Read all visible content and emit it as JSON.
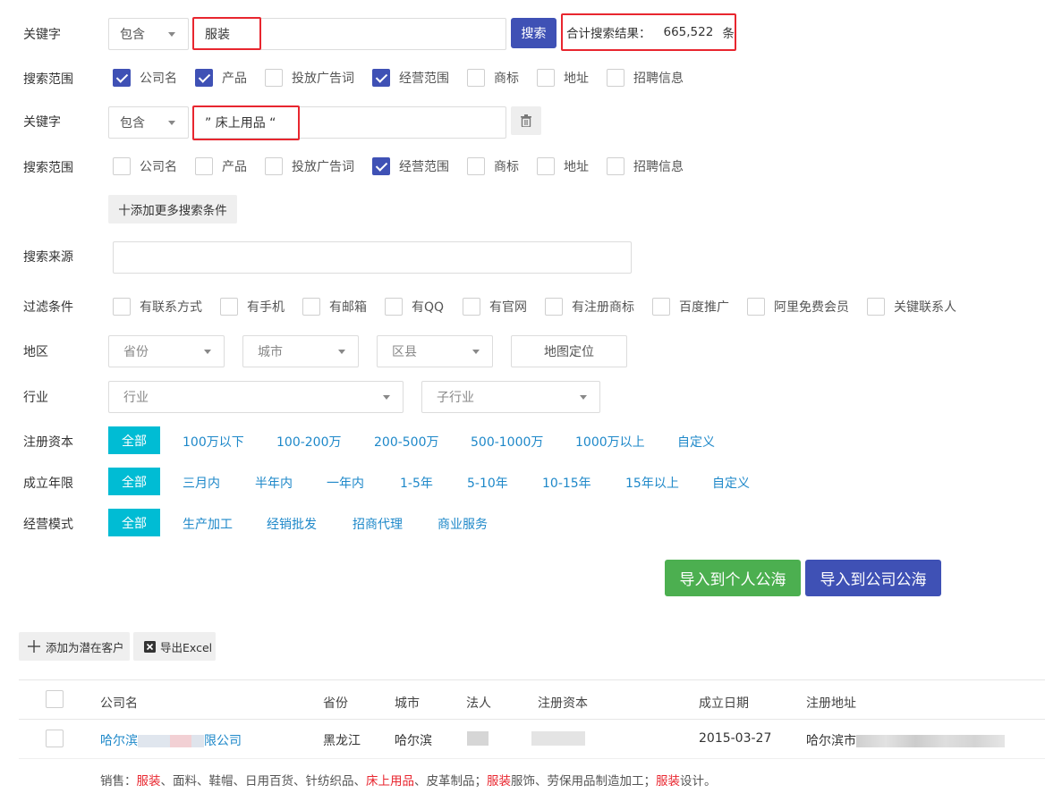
{
  "row1": {
    "label": "关键字",
    "match": "包含",
    "keyword": "服装",
    "search_btn": "搜索",
    "total_label": "合计搜索结果：",
    "total_count": "665,522",
    "total_unit": "条"
  },
  "scope1": {
    "label": "搜索范围",
    "items": [
      {
        "text": "公司名",
        "checked": true
      },
      {
        "text": "产品",
        "checked": true
      },
      {
        "text": "投放广告词",
        "checked": false
      },
      {
        "text": "经营范围",
        "checked": true
      },
      {
        "text": "商标",
        "checked": false
      },
      {
        "text": "地址",
        "checked": false
      },
      {
        "text": "招聘信息",
        "checked": false
      }
    ]
  },
  "row2": {
    "label": "关键字",
    "match": "包含",
    "keyword": "” 床上用品 “"
  },
  "scope2": {
    "label": "搜索范围",
    "items": [
      {
        "text": "公司名",
        "checked": false
      },
      {
        "text": "产品",
        "checked": false
      },
      {
        "text": "投放广告词",
        "checked": false
      },
      {
        "text": "经营范围",
        "checked": true
      },
      {
        "text": "商标",
        "checked": false
      },
      {
        "text": "地址",
        "checked": false
      },
      {
        "text": "招聘信息",
        "checked": false
      }
    ]
  },
  "add_more": "十添加更多搜索条件",
  "source": {
    "label": "搜索来源",
    "value": ""
  },
  "filters": {
    "label": "过滤条件",
    "items": [
      "有联系方式",
      "有手机",
      "有邮箱",
      "有QQ",
      "有官网",
      "有注册商标",
      "百度推广",
      "阿里免费会员",
      "关键联系人"
    ]
  },
  "region": {
    "label": "地区",
    "province": "省份",
    "city": "城市",
    "district": "区县",
    "map_btn": "地图定位"
  },
  "industry": {
    "label": "行业",
    "industry": "行业",
    "sub": "子行业"
  },
  "capital": {
    "label": "注册资本",
    "all": "全部",
    "options": [
      "100万以下",
      "100-200万",
      "200-500万",
      "500-1000万",
      "1000万以上",
      "自定义"
    ]
  },
  "years": {
    "label": "成立年限",
    "all": "全部",
    "options": [
      "三月内",
      "半年内",
      "一年内",
      "1-5年",
      "5-10年",
      "10-15年",
      "15年以上",
      "自定义"
    ]
  },
  "mode": {
    "label": "经营模式",
    "all": "全部",
    "options": [
      "生产加工",
      "经销批发",
      "招商代理",
      "商业服务"
    ]
  },
  "import_personal": "导入到个人公海",
  "import_company": "导入到公司公海",
  "toolbar": {
    "add_potential": "添加为潜在客户",
    "export": "导出Excel"
  },
  "table": {
    "headers": [
      "公司名",
      "省份",
      "城市",
      "法人",
      "注册资本",
      "成立日期",
      "注册地址"
    ],
    "row": {
      "company_prefix": "哈尔滨",
      "company_suffix": "限公司",
      "province": "黑龙江",
      "city": "哈尔滨",
      "date": "2015-03-27",
      "address_prefix": "哈尔滨市"
    },
    "sales": {
      "prefix": "销售：",
      "s1": "服装",
      "s2": "、面料、鞋帽、日用百货、针纺织品、",
      "s3": "床上用品",
      "s4": "、皮革制品；",
      "s5": "服装",
      "s6": "服饰、劳保用品制造加工；",
      "s7": "服装",
      "s8": "设计。"
    }
  },
  "colors": {
    "primary": "#3f51b5",
    "accent": "#00bcd4",
    "success": "#4caf50",
    "highlight": "#e8262f",
    "link": "#1e88c9"
  }
}
